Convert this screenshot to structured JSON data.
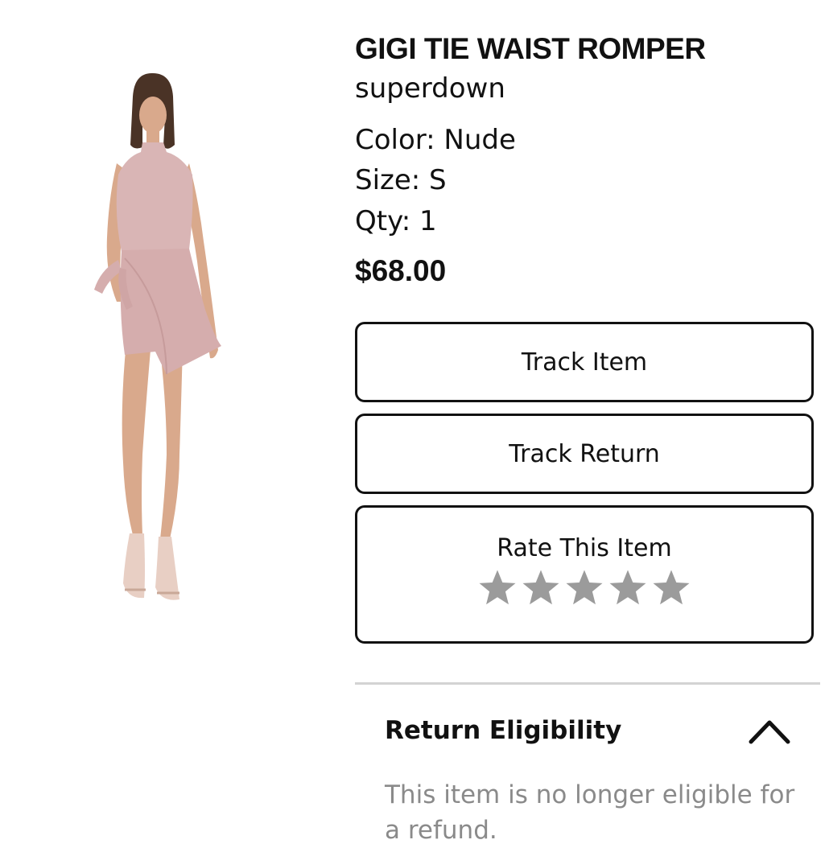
{
  "product": {
    "image_alt": "Model wearing nude halter tie waist romper",
    "title": "GIGI TIE WAIST ROMPER",
    "brand": "superdown",
    "color": "Color: Nude",
    "size": "Size: S",
    "qty": "Qty: 1",
    "price": "$68.00"
  },
  "actions": {
    "track_item": "Track Item",
    "track_return": "Track Return",
    "rate_label": "Rate This Item",
    "rating": {
      "value": 0,
      "max": 5,
      "star_color": "#9b9b9b"
    }
  },
  "return_section": {
    "title": "Return Eligibility",
    "expanded": true,
    "body": "This item is no longer eligible for a refund."
  },
  "colors": {
    "text": "#111111",
    "muted": "#8a8a8a",
    "divider": "#d3d3d3",
    "garment": "#d9b5b5",
    "skin": "#d9a98c"
  }
}
